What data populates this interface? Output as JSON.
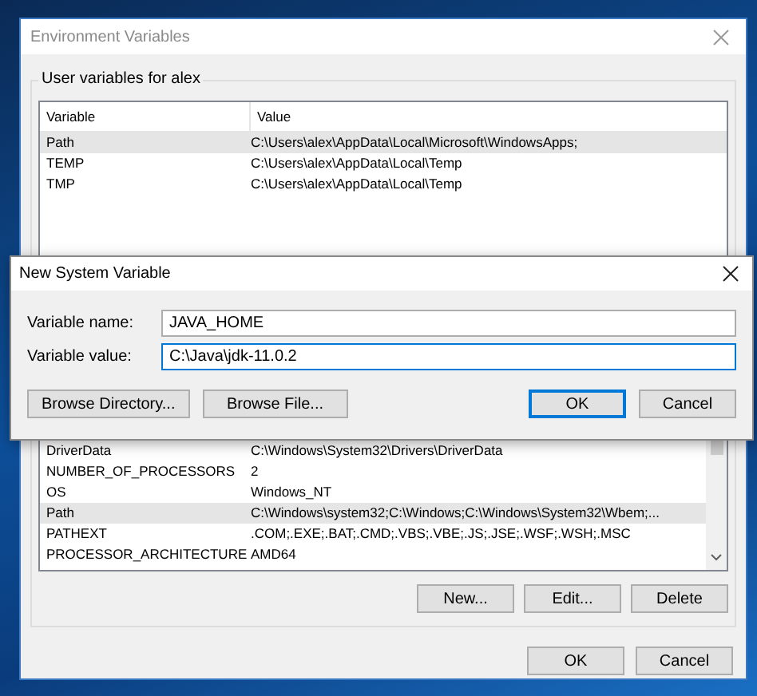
{
  "window": {
    "title": "Environment Variables"
  },
  "user_variables": {
    "title": "User variables for alex",
    "columns": [
      "Variable",
      "Value"
    ],
    "rows": [
      {
        "variable": "Path",
        "value": "C:\\Users\\alex\\AppData\\Local\\Microsoft\\WindowsApps;",
        "selected": true
      },
      {
        "variable": "TEMP",
        "value": "C:\\Users\\alex\\AppData\\Local\\Temp",
        "selected": false
      },
      {
        "variable": "TMP",
        "value": "C:\\Users\\alex\\AppData\\Local\\Temp",
        "selected": false
      }
    ]
  },
  "system_variables": {
    "rows": [
      {
        "variable": "DriverData",
        "value": "C:\\Windows\\System32\\Drivers\\DriverData",
        "selected": false
      },
      {
        "variable": "NUMBER_OF_PROCESSORS",
        "value": "2",
        "selected": false
      },
      {
        "variable": "OS",
        "value": "Windows_NT",
        "selected": false
      },
      {
        "variable": "Path",
        "value": "C:\\Windows\\system32;C:\\Windows;C:\\Windows\\System32\\Wbem;...",
        "selected": true
      },
      {
        "variable": "PATHEXT",
        "value": ".COM;.EXE;.BAT;.CMD;.VBS;.VBE;.JS;.JSE;.WSF;.WSH;.MSC",
        "selected": false
      },
      {
        "variable": "PROCESSOR_ARCHITECTURE",
        "value": "AMD64",
        "selected": false
      }
    ],
    "buttons": [
      "New...",
      "Edit...",
      "Delete"
    ]
  },
  "buttons": [
    "OK",
    "Cancel"
  ],
  "dialog": {
    "title": "New System Variable",
    "fields": [
      {
        "label": "Variable name:",
        "value": "JAVA_HOME",
        "focused": false
      },
      {
        "label": "Variable value:",
        "value": "C:\\Java\\jdk-11.0.2",
        "focused": true
      }
    ],
    "left_buttons": [
      "Browse Directory...",
      "Browse File..."
    ],
    "right_buttons": [
      {
        "label": "OK",
        "default": true
      },
      {
        "label": "Cancel",
        "default": false
      }
    ]
  }
}
